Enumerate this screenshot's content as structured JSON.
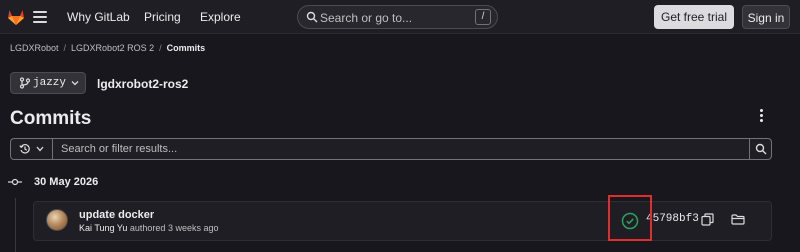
{
  "topbar": {
    "nav": [
      "Why GitLab",
      "Pricing",
      "Explore"
    ],
    "search_placeholder": "Search or go to...",
    "search_shortcut": "/",
    "trial_label": "Get free trial",
    "signin_label": "Sign in",
    "logo_color": "#e24329"
  },
  "breadcrumb": [
    "LGDXRobot",
    "LGDXRobot2 ROS 2",
    "Commits"
  ],
  "branch": {
    "name": "jazzy"
  },
  "repo_name": "lgdxrobot2-ros2",
  "page_title": "Commits",
  "filter": {
    "placeholder": "Search or filter results..."
  },
  "commit_groups": [
    {
      "date": "30 May 2026",
      "commits": [
        {
          "title": "update docker",
          "author": "Kai Tung Yu",
          "authored_text": "authored",
          "time": "3 weeks ago",
          "sha": "45798bf3",
          "pipeline_status": "passed",
          "status_color": "#2da160"
        }
      ]
    }
  ],
  "highlight_color": "#e02d2d"
}
